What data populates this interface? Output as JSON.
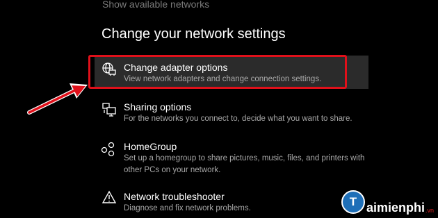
{
  "top_link": "Show available networks",
  "section_title": "Change your network settings",
  "options": [
    {
      "icon": "adapter-icon",
      "title": "Change adapter options",
      "desc": [
        "View network adapters and change connection settings."
      ]
    },
    {
      "icon": "sharing-icon",
      "title": "Sharing options",
      "desc": [
        "For the networks you connect to, decide what you want to share."
      ]
    },
    {
      "icon": "homegroup-icon",
      "title": "HomeGroup",
      "desc": [
        "Set up a homegroup to share pictures, music, files, and printers with",
        "other PCs on your network."
      ]
    },
    {
      "icon": "warning-icon",
      "title": "Network troubleshooter",
      "desc": [
        "Diagnose and fix network problems."
      ]
    }
  ],
  "colors": {
    "highlight": "#e0101a",
    "arrow": "#e0101a",
    "background": "#000000",
    "active_row": "#2b2b2b"
  },
  "watermark": {
    "text": "aimienphi",
    "suffix": ".vn",
    "logo_letter": "T"
  }
}
